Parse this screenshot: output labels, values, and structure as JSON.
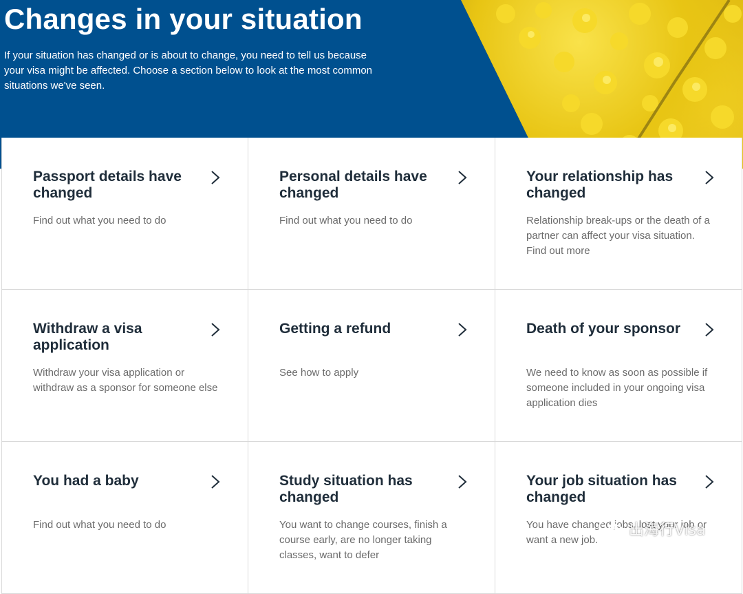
{
  "hero": {
    "title": "Changes in your situation",
    "intro": "If your situation has changed or is about to change, you need to tell us because your visa might be affected. Choose a section below to look at the most common situations we've seen."
  },
  "cards": [
    {
      "title": "Passport details have changed",
      "description": "Find out what you need to do"
    },
    {
      "title": "Personal details have changed",
      "description": "Find out what you need to do"
    },
    {
      "title": "Your relationship has changed",
      "description": "Relationship break-ups or the death of a partner can affect your visa situation. Find out more"
    },
    {
      "title": "Withdraw a visa application",
      "description": "Withdraw your visa application or withdraw as a sponsor for someone else"
    },
    {
      "title": "Getting a refund",
      "description": "See how to apply"
    },
    {
      "title": "Death of your sponsor",
      "description": "We need to know as soon as possible if someone included in your ongoing visa application dies"
    },
    {
      "title": "You had a baby",
      "description": "Find out what you need to do"
    },
    {
      "title": "Study situation has changed",
      "description": "You want to change courses, finish a course early, are no longer taking classes, want to defer"
    },
    {
      "title": "Your job situation has changed",
      "description": "You have changed jobs, lost your job or want a new job."
    }
  ],
  "watermark": {
    "text": "出海行Visa",
    "icon": "wechat-icon"
  },
  "colors": {
    "hero_background": "#00508f",
    "title_text": "#1f2d3a",
    "description_text": "#6b6b6b",
    "card_border": "#d9d9d9"
  }
}
